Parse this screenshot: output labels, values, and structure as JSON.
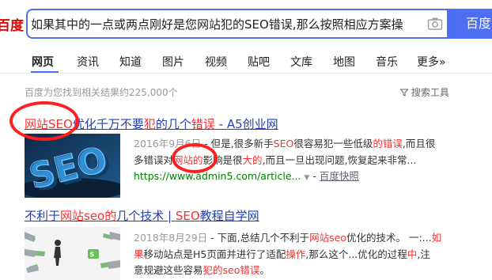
{
  "header": {
    "logo": "百度",
    "query": "如果其中的一点或两点刚好是您网站犯的SEO错误,那么按照相应方案操",
    "search_button": "百度一下"
  },
  "tabs": [
    "网页",
    "资讯",
    "知道",
    "图片",
    "视频",
    "贴吧",
    "文库",
    "地图",
    "音乐",
    "更多»"
  ],
  "result_count": "百度为您找到相关结果约225,000个",
  "search_tools": "搜索工具",
  "results": [
    {
      "title": {
        "p1": "网站SEO",
        "p2": "优化千万不要",
        "p3": "犯",
        "p4": "的几个",
        "p5": "错误",
        "p6": " - A5创业网"
      },
      "line1": {
        "date": "2016年9月6日",
        "a": " - 但是,很多新手",
        "b": "SEO",
        "c": "很容易犯一些低级",
        "d": "的错误",
        "e": ",而且很"
      },
      "line2": {
        "a": "多错误对",
        "b": "网站的",
        "c": "影响是很",
        "d": "大的",
        "e": ",而且一旦出现问题,恢复起来非常..."
      },
      "line3": {
        "url": "https://www.admin5.com/article...",
        "snapshot": "百度快照"
      }
    },
    {
      "title": {
        "p1": "不利于",
        "p2": "网站seo的",
        "p3": "几个技术 | ",
        "p4": "SEO",
        "p5": "教程自学网"
      },
      "line1": {
        "date": "2018年8月29日",
        "a": " - 下面,总结几个不利于",
        "b": "网站seo",
        "c": "优化的技术。 一:...",
        "d": "如"
      },
      "line2": {
        "a": "果",
        "b": "移动站点是H5页面并进行了适配",
        "c": "操作",
        "d": ",那么这个...优化的过程",
        "e": "中",
        "f": ",注"
      },
      "line3": {
        "a": "意规避这些容易",
        "b": "犯的seo错误",
        "c": "。"
      }
    }
  ]
}
